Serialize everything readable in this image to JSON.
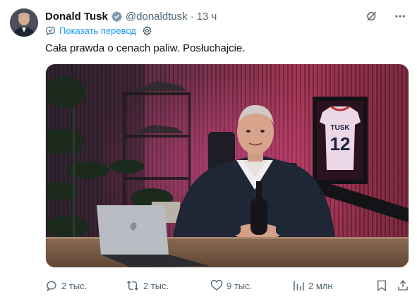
{
  "author": {
    "name": "Donald Tusk",
    "handle": "@donaldtusk",
    "separator": "·",
    "time": "13 ч"
  },
  "translate": {
    "label": "Показать перевод"
  },
  "tweet": {
    "text": "Cała prawda o cenach paliw. Posłuchajcie."
  },
  "media": {
    "jersey_name": "TUSK",
    "jersey_number": "12"
  },
  "actions": {
    "replies": "2 тыс.",
    "retweets": "2 тыс.",
    "likes": "9 тыс.",
    "views": "2 млн"
  },
  "colors": {
    "accent": "#1d9bf0",
    "verified": "#829aab",
    "muted": "#536471"
  },
  "icons": [
    "verified-badge-icon",
    "grok-icon",
    "more-icon",
    "translate-icon",
    "gear-icon",
    "reply-icon",
    "retweet-icon",
    "like-icon",
    "views-icon",
    "bookmark-icon",
    "share-icon"
  ]
}
